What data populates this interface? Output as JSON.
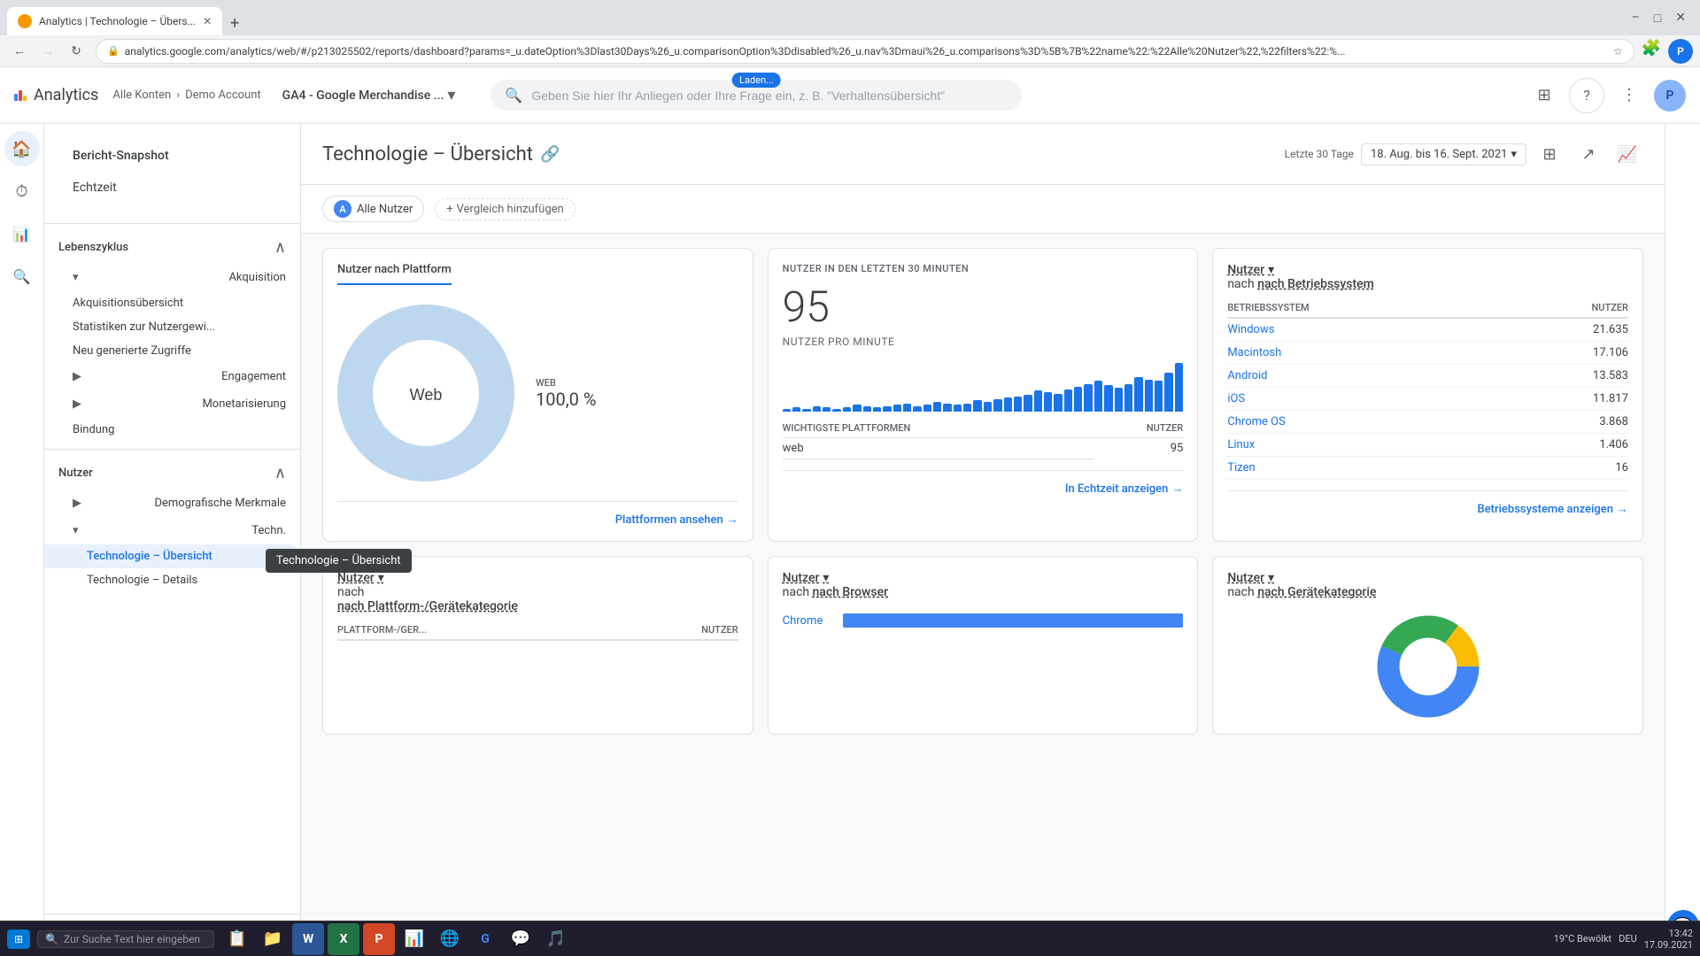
{
  "browser": {
    "tab_title": "Analytics | Technologie – Übers...",
    "tab_icon": "analytics-icon",
    "url": "analytics.google.com/analytics/web/#/p213025502/reports/dashboard?params=_u.dateOption%3Dlast30Days%26_u.comparisonOption%3Ddisabled%26_u.nav%3Dmaui%26_u.comparisons%3D%5B%7B%22name%22:%22Alle%20Nutzer%22,%22filters%22:%...",
    "new_tab_label": "+",
    "min_btn": "–",
    "max_btn": "□",
    "close_btn": "✕",
    "loading_text": "Laden..."
  },
  "header": {
    "logo_text": "Analytics",
    "breadcrumb": {
      "all_accounts": "Alle Konten",
      "separator": "›",
      "account_name": "Demo Account",
      "property_name": "GA4 - Google Merchandise ...",
      "dropdown_arrow": "▾"
    },
    "search_placeholder": "Geben Sie hier Ihr Anliegen oder Ihre Frage ein, z. B. \"Verhaltensübersicht\"",
    "loading_badge": "Laden...",
    "icons": {
      "apps": "⊞",
      "help": "?",
      "more": "⋮"
    },
    "avatar_initials": "P"
  },
  "sidebar": {
    "snapshot_label": "Bericht-Snapshot",
    "realtime_label": "Echtzeit",
    "sections": [
      {
        "id": "lebenszyklus",
        "label": "Lebenszyklus",
        "expanded": true,
        "children": [
          {
            "id": "akquisition",
            "label": "Akquisition",
            "expanded": true,
            "children": [
              {
                "id": "akquisitionsuebersicht",
                "label": "Akquisitionsübersicht"
              },
              {
                "id": "statistiken",
                "label": "Statistiken zur Nutzergewi..."
              },
              {
                "id": "neu-generierte",
                "label": "Neu generierte Zugriffe"
              }
            ]
          },
          {
            "id": "engagement",
            "label": "Engagement",
            "expanded": false
          },
          {
            "id": "monetarisierung",
            "label": "Monetarisierung",
            "expanded": false
          },
          {
            "id": "bindung",
            "label": "Bindung"
          }
        ]
      },
      {
        "id": "nutzer",
        "label": "Nutzer",
        "expanded": true,
        "children": [
          {
            "id": "demografische",
            "label": "Demografische Merkmale",
            "expanded": false
          },
          {
            "id": "techn",
            "label": "Techn.",
            "expanded": true,
            "children": [
              {
                "id": "technologie-uebersicht",
                "label": "Technologie – Übersicht",
                "active": true
              },
              {
                "id": "technologie-details",
                "label": "Technologie – Details"
              }
            ]
          }
        ]
      }
    ],
    "collapse_icon": "❮",
    "settings_icon": "⚙"
  },
  "page": {
    "title": "Technologie – Übersicht",
    "save_icon": "💾",
    "date_range": {
      "label": "Letzte 30 Tage",
      "value": "18. Aug. bis 16. Sept. 2021",
      "dropdown": "▾"
    },
    "action_icons": {
      "customize": "⊞",
      "share": "↗",
      "chart": "📈"
    },
    "filter_bar": {
      "chip_label": "Alle Nutzer",
      "chip_icon": "A",
      "add_filter_label": "Vergleich hinzufügen",
      "add_icon": "+"
    }
  },
  "card_platform": {
    "title": "Nutzer nach Plattform",
    "donut_label": "Web",
    "legend": [
      {
        "label": "WEB",
        "value": "100,0 %"
      }
    ],
    "footer_link": "Plattformen ansehen",
    "footer_arrow": "→",
    "chart_data": [
      {
        "label": "Web",
        "value": 100,
        "color": "#bdd7ee"
      }
    ]
  },
  "card_realtime": {
    "header": "NUTZER IN DEN LETZTEN 30 MINUTEN",
    "count": "95",
    "per_minute_label": "NUTZER PRO MINUTE",
    "table_headers": [
      "WICHTIGSTE PLATTFORMEN",
      "NUTZER"
    ],
    "rows": [
      {
        "platform": "web",
        "count": "95"
      }
    ],
    "footer_link": "In Echtzeit anzeigen",
    "footer_arrow": "→",
    "bars": [
      2,
      3,
      2,
      4,
      3,
      2,
      3,
      5,
      4,
      3,
      4,
      5,
      6,
      4,
      5,
      7,
      6,
      5,
      6,
      8,
      7,
      9,
      10,
      11,
      12,
      15,
      14,
      13,
      16,
      18,
      20,
      22,
      19,
      17,
      20,
      25,
      23,
      22,
      28,
      35
    ]
  },
  "card_os": {
    "title_nutzer": "Nutzer",
    "title_nach": "nach Betriebssystem",
    "title_dropdown": "▾",
    "col_os": "BETRIEBSSYSTEM",
    "col_nutzer": "NUTZER",
    "rows": [
      {
        "os": "Windows",
        "count": "21.635"
      },
      {
        "os": "Macintosh",
        "count": "17.106"
      },
      {
        "os": "Android",
        "count": "13.583"
      },
      {
        "os": "iOS",
        "count": "11.817"
      },
      {
        "os": "Chrome OS",
        "count": "3.868"
      },
      {
        "os": "Linux",
        "count": "1.406"
      },
      {
        "os": "Tizen",
        "count": "16"
      }
    ],
    "footer_link": "Betriebssysteme anzeigen",
    "footer_arrow": "→"
  },
  "card_platform_device": {
    "title_nutzer": "Nutzer",
    "title_nach": "nach Plattform-/Gerätekategorie",
    "title_dropdown": "▾",
    "col_platform": "PLATTFORM-/GER...",
    "col_nutzer": "NUTZER"
  },
  "card_browser": {
    "title_nutzer": "Nutzer",
    "title_nach": "nach Browser",
    "title_dropdown": "▾",
    "rows": [
      {
        "browser": "Chrome",
        "value": 85
      }
    ]
  },
  "card_device": {
    "title_nutzer": "Nutzer",
    "title_nach": "nach Gerätekategorie",
    "title_dropdown": "▾"
  },
  "tooltip": {
    "text": "Technologie – Übersicht"
  },
  "taskbar": {
    "start_icon": "⊞",
    "search_placeholder": "Zur Suche Text hier eingeben",
    "search_icon": "🔍",
    "apps": [
      "📋",
      "📁",
      "W",
      "X",
      "P",
      "📊",
      "🌐",
      "🔧",
      "💬",
      "🎵"
    ],
    "weather": "19°C  Bewölkt",
    "language": "DEU",
    "time": "13:42",
    "date": "17.09.2021"
  },
  "nav_icons": {
    "home": "🏠",
    "realtime": "⏱",
    "reports": "📊",
    "explore": "🔍",
    "config": "⚙"
  },
  "colors": {
    "primary": "#1a73e8",
    "accent": "#4285f4",
    "donut_web": "#bdd7ee",
    "sidebar_active_bg": "#e8f0fe",
    "sidebar_active_text": "#1a73e8"
  }
}
